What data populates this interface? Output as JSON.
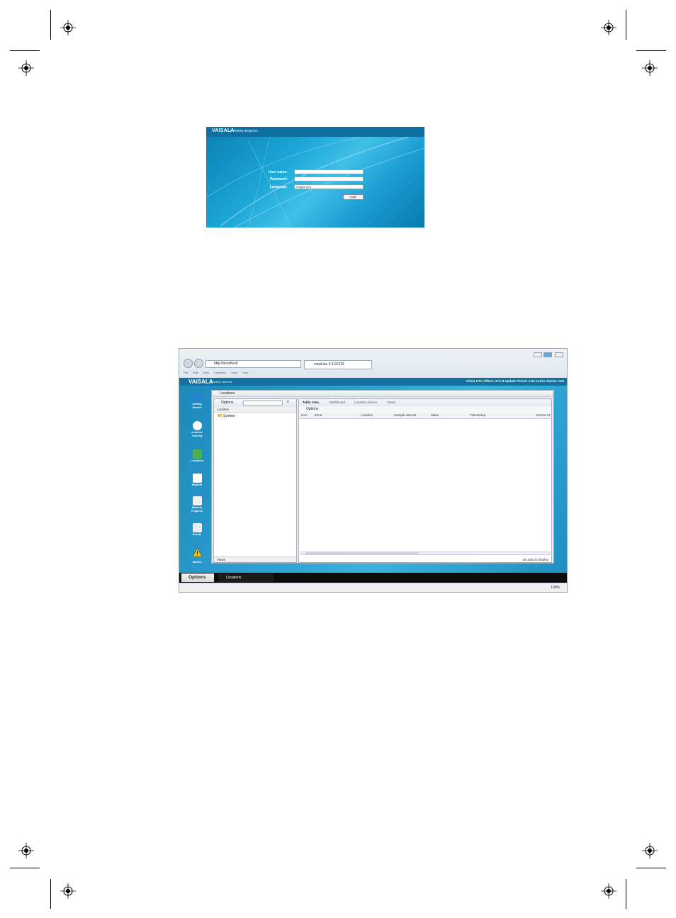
{
  "login_screenshot": {
    "brand": "VAISALA",
    "product": "| Veriteq viewLinc",
    "labels": {
      "username": "User name:",
      "password": "Password:",
      "language": "Language:"
    },
    "language_value": "English [en]",
    "login_button": "Login"
  },
  "app_screenshot": {
    "browser": {
      "url": "http://localhost/",
      "tab_title": "viewLinc 4.3.01216",
      "menu": "File Edit View Favorites Tools Help"
    },
    "brand": "VAISALA",
    "product": "| Veriteq viewLinc",
    "status": "Client UTC Offset: UTC-8  Update Period: 1:00  Active Alarms: 103",
    "sidebar": [
      {
        "label": "Getting Started",
        "icon": "help-icon"
      },
      {
        "label": "viewLinc Training",
        "icon": "training-icon"
      },
      {
        "label": "Locations",
        "icon": "locations-icon"
      },
      {
        "label": "Reports",
        "icon": "reports-icon"
      },
      {
        "label": "Reports Progress",
        "icon": "reports-progress-icon"
      },
      {
        "label": "Events",
        "icon": "events-icon"
      },
      {
        "label": "Alarms",
        "icon": "alarm-icon"
      }
    ],
    "panel_title": "Locations",
    "left_pane": {
      "options": "Options",
      "header": "Location",
      "tree_root": "System",
      "footer": "Views"
    },
    "tabs": [
      "Table View",
      "Dashboard",
      "Location Alarms",
      "Trend"
    ],
    "right_options": "Options",
    "columns": [
      "Icon",
      "Zone",
      "Location",
      "Sample Interval",
      "Value",
      "Timestamp",
      "Device St"
    ],
    "no_data": "No data to display",
    "taskbar": {
      "options": "Options",
      "window": "Locations"
    },
    "zoom": "100%"
  }
}
